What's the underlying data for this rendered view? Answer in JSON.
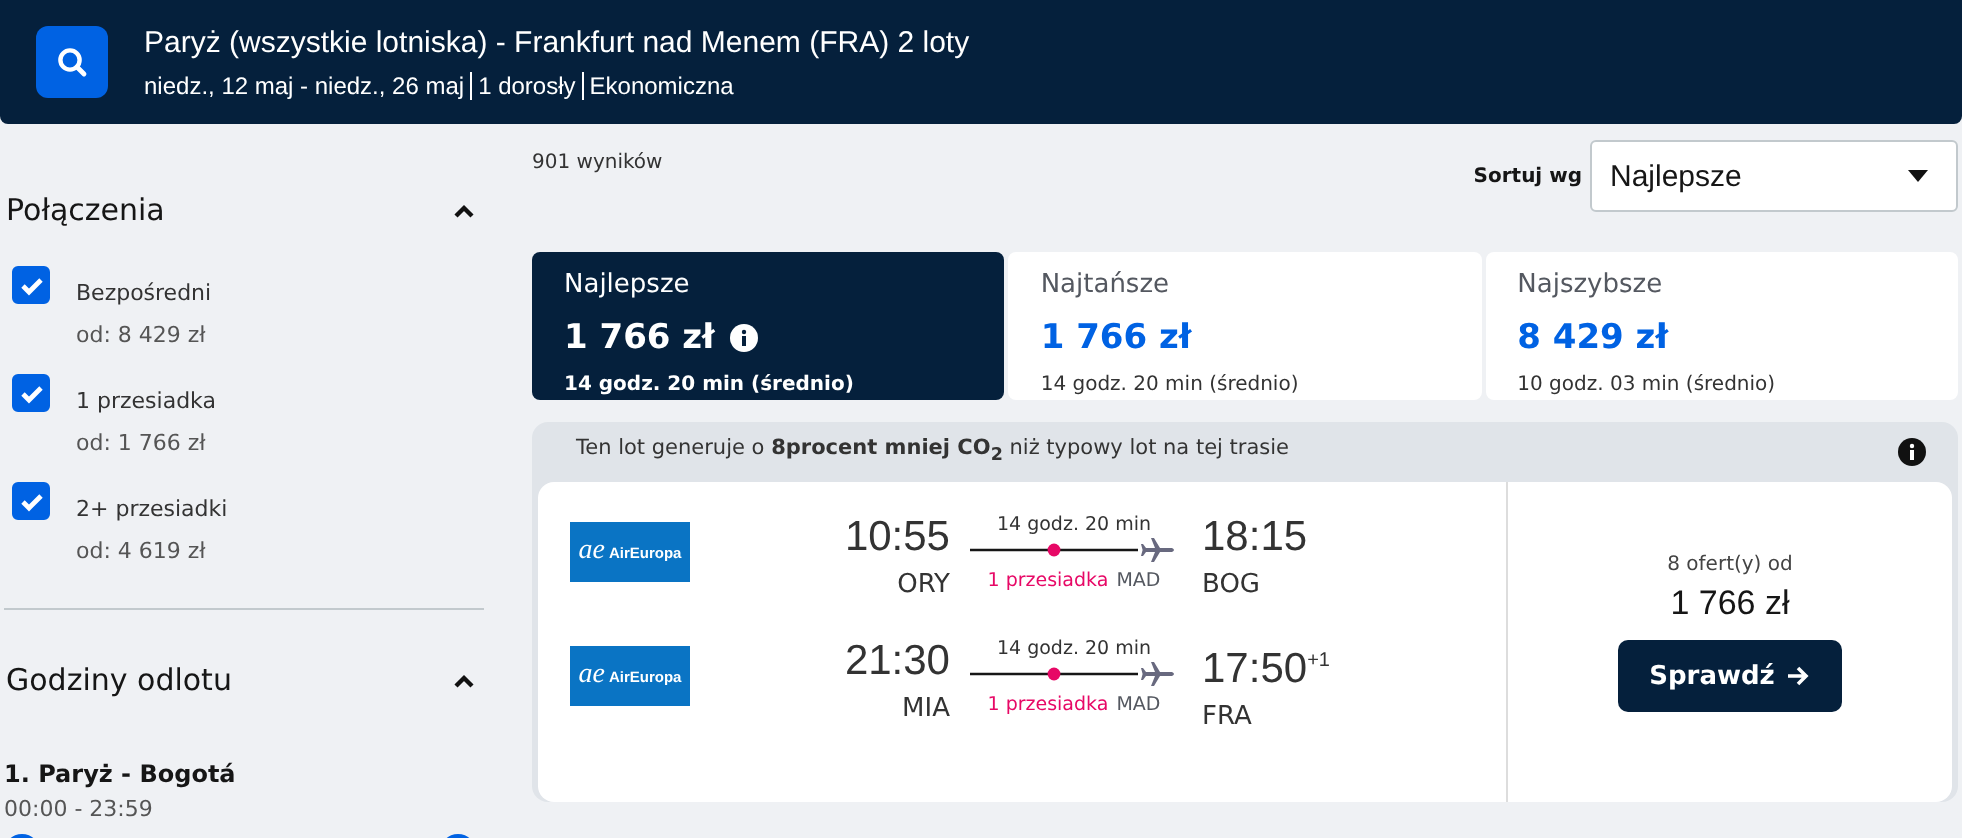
{
  "header": {
    "title": "Paryż (wszystkie lotniska) - Frankfurt nad Menem (FRA) 2 loty",
    "details": [
      "niedz., 12 maj - niedz., 26 maj",
      "1 dorosły",
      "Ekonomiczna"
    ]
  },
  "filters": {
    "title": "Połączenia",
    "expanded": true,
    "options": [
      {
        "label": "Bezpośredni",
        "price": "od: 8 429 zł",
        "checked": true
      },
      {
        "label": "1 przesiadka",
        "price": "od: 1 766 zł",
        "checked": true
      },
      {
        "label": "2+ przesiadki",
        "price": "od: 4 619 zł",
        "checked": true
      }
    ]
  },
  "departure_times": {
    "title": "Godziny odlotu",
    "expanded": true,
    "route": "1. Paryż - Bogotá",
    "range": "00:00 - 23:59"
  },
  "results_count": "901 wyników",
  "sort": {
    "label": "Sortuj wg",
    "value": "Najlepsze"
  },
  "sort_tabs": [
    {
      "label": "Najlepsze",
      "price": "1 766 zł",
      "duration": "14 godz. 20 min (średnio)",
      "selected": true
    },
    {
      "label": "Najtańsze",
      "price": "1 766 zł",
      "duration": "14 godz. 20 min (średnio)",
      "selected": false
    },
    {
      "label": "Najszybsze",
      "price": "8 429 zł",
      "duration": "10 godz. 03 min (średnio)",
      "selected": false
    }
  ],
  "result": {
    "banner": "Ten lot generuje o **8procent mniej CO$_{2}$** niż typowy lot na tej trasie",
    "legs": [
      {
        "logo_mark": "ae",
        "airline": "AirEuropa",
        "depart_time": "10:55",
        "depart_airport": "ORY",
        "duration": "14 godz. 20 min",
        "stops": "1 przesiadka",
        "stop_airport": "MAD",
        "arrive_time": "18:15",
        "arrive_airport": "BOG"
      },
      {
        "logo_mark": "ae",
        "airline": "AirEuropa",
        "depart_time": "21:30",
        "depart_airport": "MIA",
        "duration": "14 godz. 20 min",
        "stops": "1 przesiadka",
        "stop_airport": "MAD",
        "arrive_time": "17:50",
        "day_offset": "+1",
        "arrive_airport": "FRA"
      }
    ],
    "offers": "8 ofert(y) od",
    "price": "1 766 zł",
    "button": "Sprawdź"
  }
}
